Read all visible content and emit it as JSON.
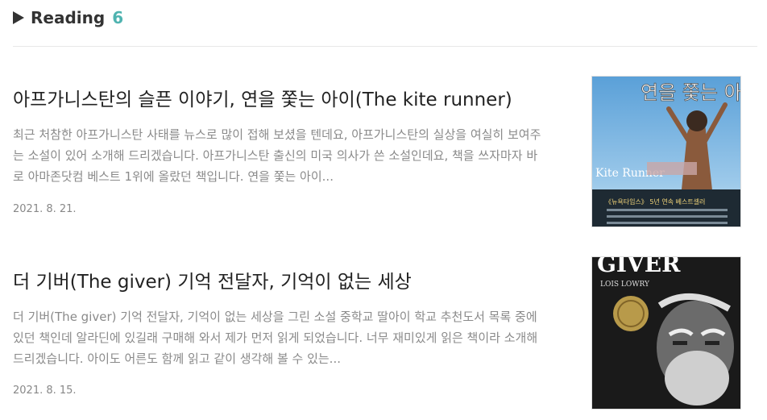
{
  "header": {
    "title": "Reading",
    "count": "6"
  },
  "posts": [
    {
      "title": "아프가니스탄의 슬픈 이야기, 연을 쫓는 아이(The kite runner)",
      "excerpt": "최근 처참한 아프가니스탄 사태를 뉴스로 많이 접해 보셨을 텐데요, 아프가니스탄의 실상을 여실히 보여주는 소설이 있어 소개해 드리겠습니다. 아프가니스탄 출신의 미국 의사가 쓴 소설인데요, 책을 쓰자마자 바로 아마존닷컴 베스트 1위에 올랐던 책입니다. 연을 쫓는 아이...",
      "date": "2021. 8. 21.",
      "cover": {
        "title": "연을 쫓는 아이",
        "band": "《뉴욕타임스》 5년 연속 베스트셀러",
        "text_en": "Kite Runner"
      }
    },
    {
      "title": "더 기버(The giver) 기억 전달자, 기억이 없는 세상",
      "excerpt": "더 기버(The giver) 기억 전달자, 기억이 없는 세상을 그린 소설 중학교 딸아이 학교 추천도서 목록 중에 있던 책인데 알라딘에 있길래 구매해 와서 제가 먼저 읽게 되었습니다. 너무 재미있게 읽은 책이라 소개해 드리겠습니다. 아이도 어른도 함께 읽고 같이 생각해 볼 수 있는...",
      "date": "2021. 8. 15.",
      "cover": {
        "title": "GIVER",
        "author": "LOIS LOWRY"
      }
    }
  ]
}
